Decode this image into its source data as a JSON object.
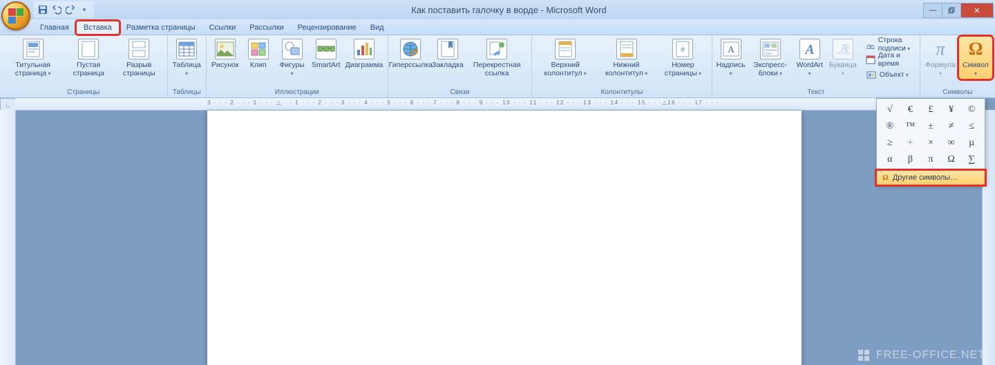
{
  "title": "Как поставить галочку в ворде - Microsoft Word",
  "tabs": [
    "Главная",
    "Вставка",
    "Разметка страницы",
    "Ссылки",
    "Рассылки",
    "Рецензирование",
    "Вид"
  ],
  "active_tab": 1,
  "groups": {
    "pages": {
      "label": "Страницы",
      "items": [
        "Титульная страница",
        "Пустая страница",
        "Разрыв страницы"
      ]
    },
    "tables": {
      "label": "Таблицы",
      "item": "Таблица"
    },
    "illus": {
      "label": "Иллюстрации",
      "items": [
        "Рисунок",
        "Клип",
        "Фигуры",
        "SmartArt",
        "Диаграмма"
      ]
    },
    "links": {
      "label": "Связи",
      "items": [
        "Гиперссылка",
        "Закладка",
        "Перекрестная ссылка"
      ]
    },
    "hf": {
      "label": "Колонтитулы",
      "items": [
        "Верхний колонтитул",
        "Нижний колонтитул",
        "Номер страницы"
      ]
    },
    "text": {
      "label": "Текст",
      "big": [
        "Надпись",
        "Экспресс-блоки",
        "WordArt",
        "Буквица"
      ],
      "small": [
        "Строка подписи",
        "Дата и время",
        "Объект"
      ]
    },
    "symbols": {
      "label": "Символы",
      "items": [
        "Формула",
        "Символ"
      ]
    }
  },
  "symbol_dropdown": {
    "grid": [
      "√",
      "€",
      "£",
      "¥",
      "©",
      "®",
      "™",
      "±",
      "≠",
      "≤",
      "≥",
      "÷",
      "×",
      "∞",
      "µ",
      "α",
      "β",
      "π",
      "Ω",
      "∑"
    ],
    "more": "Другие символы…"
  },
  "ruler": "3 · · · 2 · · · 1 · · · △ · · 1 · · · 2 · · · 3 · · · 4 · · · 5 · · · 6 · · · 7 · · · 8 · · · 9 · · · 10 · · · 11 · · · 12 · · · 13 · · · 14 · · · 15 · · ·△16 · · · 17 · · ·",
  "watermark": "FREE-OFFICE.NET"
}
